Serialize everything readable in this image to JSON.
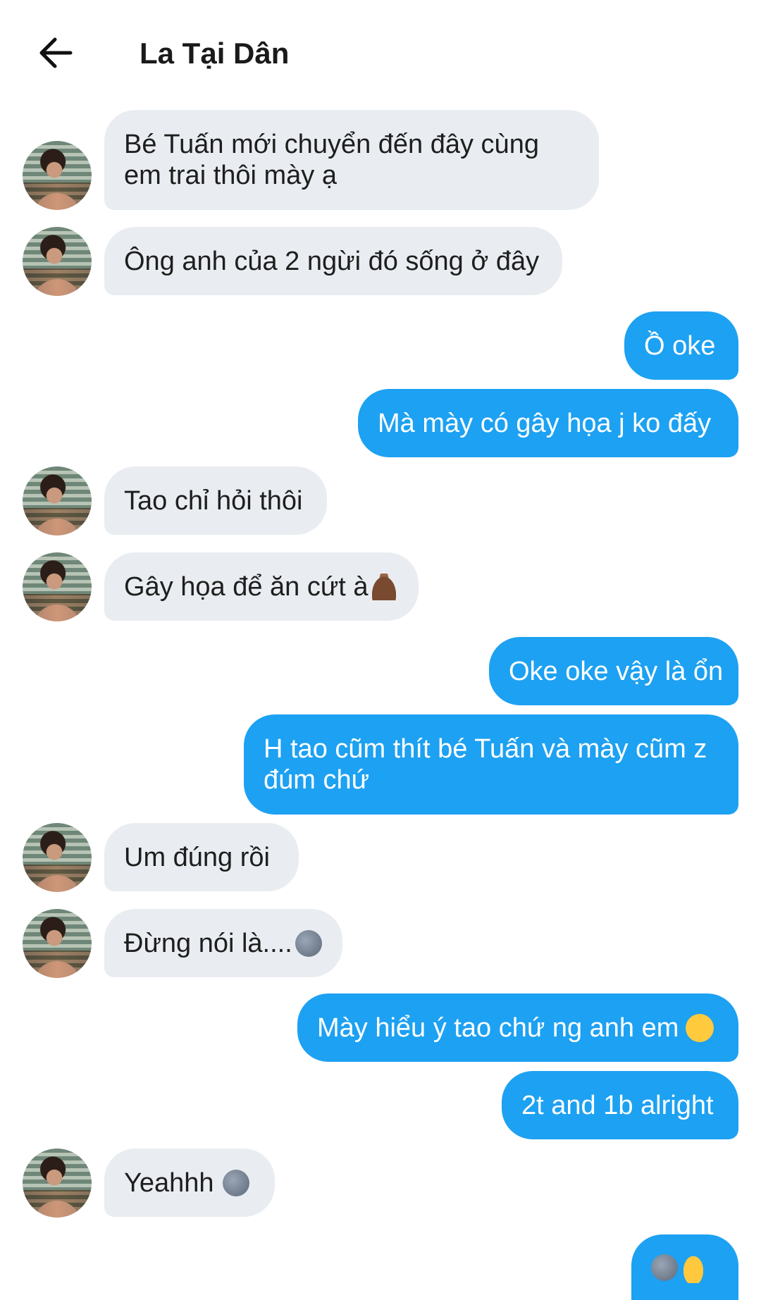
{
  "header": {
    "title": "La Tại Dân",
    "back_icon": "arrow-left-icon"
  },
  "colors": {
    "incoming_bubble": "#e9edf1",
    "outgoing_bubble": "#1da1f2",
    "incoming_text": "#1e1e1e",
    "outgoing_text": "#ffffff"
  },
  "messages": [
    {
      "direction": "in",
      "text": "Bé Tuấn mới chuyển đến đây cùng em trai thôi mày ạ"
    },
    {
      "direction": "in",
      "text": "Ông anh của 2 ngừi đó sống ở đây"
    },
    {
      "direction": "out",
      "text": "Ồ oke"
    },
    {
      "direction": "out",
      "text": "Mà mày có gây họa j ko đấy"
    },
    {
      "direction": "in",
      "text": "Tao chỉ hỏi thôi"
    },
    {
      "direction": "in",
      "text": "Gây họa để ăn cứt à",
      "emoji": "poop-emoji"
    },
    {
      "direction": "out",
      "text": "Oke oke vậy là ổn"
    },
    {
      "direction": "out",
      "text": "H tao cũm thít bé Tuấn và mày cũm z đúm chứ"
    },
    {
      "direction": "in",
      "text": "Um đúng rồi"
    },
    {
      "direction": "in",
      "text": "Đừng nói là....",
      "emoji": "new-moon-face-emoji"
    },
    {
      "direction": "out",
      "text": "Mày hiểu ý tao chứ ng anh em",
      "emoji": "star-struck-emoji"
    },
    {
      "direction": "out",
      "text": "2t and 1b alright"
    },
    {
      "direction": "in",
      "text": "Yeahhh",
      "emoji": "new-moon-face-emoji"
    },
    {
      "direction": "out",
      "text": "",
      "emoji": "new-moon-face-emoji ok-hand-emoji"
    }
  ]
}
